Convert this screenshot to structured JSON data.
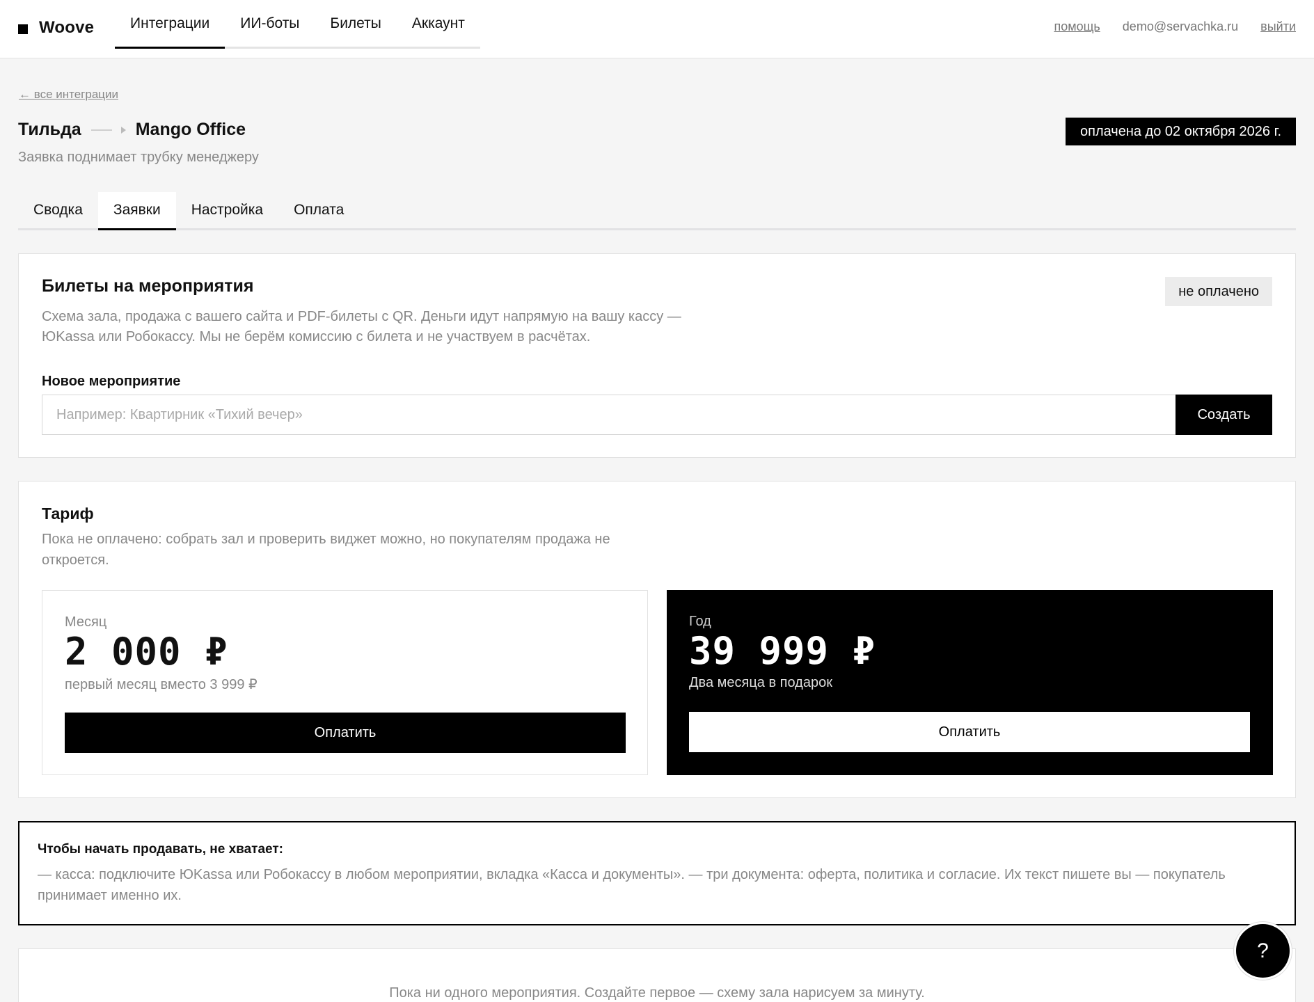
{
  "header": {
    "logo": "Woove",
    "nav": [
      "Интеграции",
      "ИИ-боты",
      "Билеты",
      "Аккаунт"
    ],
    "active_nav_index": 0,
    "help_link": "помощь",
    "user_email": "demo@servachka.ru",
    "logout_link": "выйти"
  },
  "page": {
    "back_link": "← все интеграции",
    "breadcrumb_from": "Тильда",
    "breadcrumb_to": "Mango Office",
    "subtitle": "Заявка поднимает трубку менеджеру",
    "paid_badge": "оплачена до 02 октября 2026 г."
  },
  "tabs": {
    "items": [
      "Сводка",
      "Заявки",
      "Настройка",
      "Оплата"
    ],
    "active_index": 1
  },
  "events": {
    "title": "Билеты на мероприятия",
    "status": "не оплачено",
    "description_line1": "Схема зала, продажа с вашего сайта и PDF-билеты с QR. Деньги идут напрямую на вашу кассу —",
    "description_line2": "ЮKassa или Робокассу. Мы не берём комиссию с билета и не участвуем в расчётах.",
    "field_label": "Новое мероприятие",
    "input_value": "",
    "input_placeholder": "Например: Квартирник «Тихий вечер»",
    "create_button": "Создать"
  },
  "tariff": {
    "title": "Тариф",
    "description_line1": "Пока не оплачено: собрать зал и проверить виджет можно, но покупателям продажа не",
    "description_line2": "откроется.",
    "month": {
      "label": "Месяц",
      "price": "2 000 ₽",
      "note": "первый месяц вместо 3 999 ₽",
      "button": "Оплатить"
    },
    "year": {
      "label": "Год",
      "price": "39 999 ₽",
      "note": "Два месяца в подарок",
      "button": "Оплатить"
    }
  },
  "missing": {
    "title": "Чтобы начать продавать, не хватает:",
    "text_line1": "— касса: подключите ЮKassa или Робокассу в любом мероприятии, вкладка «Касса и документы». — три документа: оферта, политика и согласие. Их текст пишете вы — покупатель",
    "text_line2": "принимает именно их."
  },
  "empty_state": {
    "text": "Пока ни одного мероприятия. Создайте первое — схему зала нарисуем за минуту."
  },
  "fab": {
    "label": "?",
    "icon": "help-icon"
  },
  "colors": {
    "accent": "#000000",
    "background": "#f5f5f5",
    "muted_text": "#888888"
  }
}
